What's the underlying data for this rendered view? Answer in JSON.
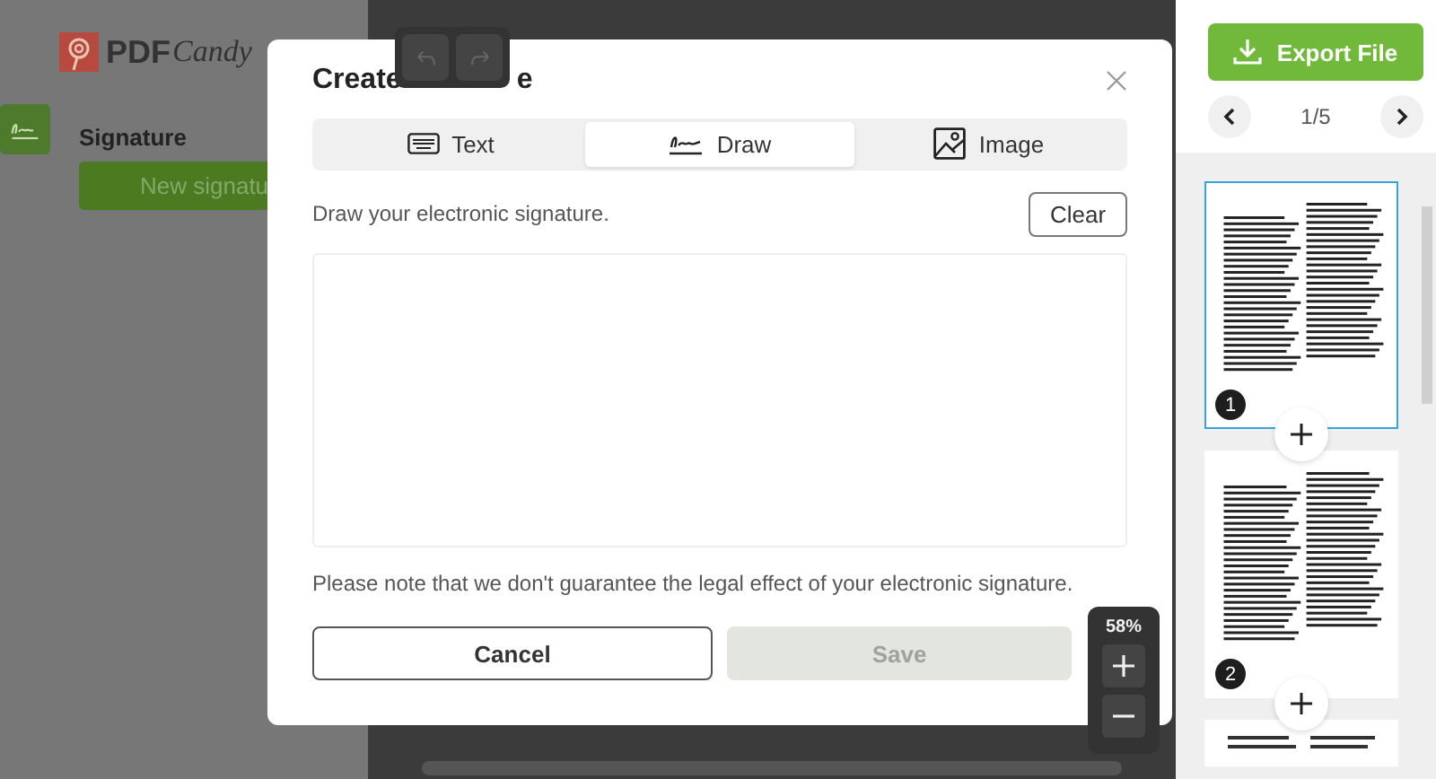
{
  "logo": {
    "part_1": "PDF",
    "part_2": "Candy"
  },
  "sidebar": {
    "title": "Signature",
    "button": "New signatu"
  },
  "modal": {
    "title_parts": [
      "Create",
      "e"
    ],
    "tabs": [
      {
        "label": "Text",
        "kind": "keyboard",
        "selected": false
      },
      {
        "label": "Draw",
        "kind": "signature",
        "selected": true
      },
      {
        "label": "Image",
        "kind": "image",
        "selected": false
      }
    ],
    "instruction": "Draw your electronic signature.",
    "clear": "Clear",
    "note": "Please note that we don't guarantee the legal effect of your electronic signature.",
    "cancel": "Cancel",
    "save": {
      "label": "Save",
      "disabled": true
    }
  },
  "zoom": {
    "reading": "58%"
  },
  "export": "Export File",
  "pager": "1/5",
  "thumbnails": [
    {
      "number": "1",
      "selected": true
    },
    {
      "number": "2",
      "selected": false
    }
  ]
}
